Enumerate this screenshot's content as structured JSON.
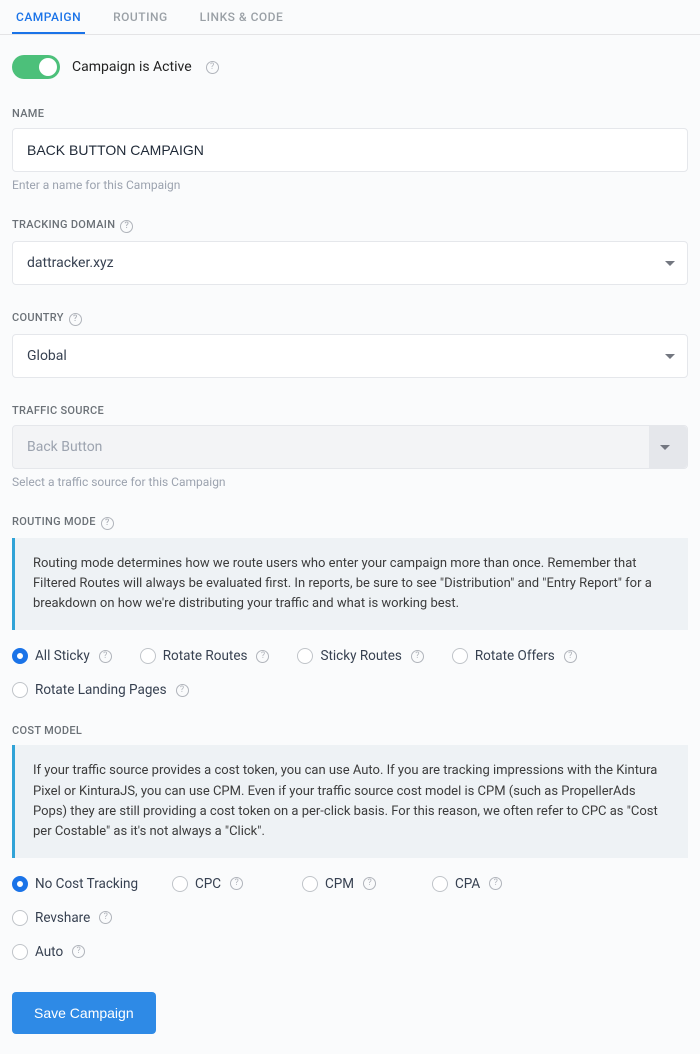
{
  "tabs": {
    "campaign": "CAMPAIGN",
    "routing": "ROUTING",
    "links": "LINKS & CODE"
  },
  "toggle": {
    "label": "Campaign is Active"
  },
  "name": {
    "label": "NAME",
    "value": "BACK BUTTON CAMPAIGN",
    "hint": "Enter a name for this Campaign"
  },
  "trackingDomain": {
    "label": "TRACKING DOMAIN",
    "value": "dattracker.xyz"
  },
  "country": {
    "label": "COUNTRY",
    "value": "Global"
  },
  "trafficSource": {
    "label": "TRAFFIC SOURCE",
    "value": "Back Button",
    "hint": "Select a traffic source for this Campaign"
  },
  "routingMode": {
    "label": "ROUTING MODE",
    "info": "Routing mode determines how we route users who enter your campaign more than once. Remember that Filtered Routes will always be evaluated first. In reports, be sure to see \"Distribution\" and \"Entry Report\" for a breakdown on how we're distributing your traffic and what is working best.",
    "options": {
      "allSticky": "All Sticky",
      "rotateRoutes": "Rotate Routes",
      "stickyRoutes": "Sticky Routes",
      "rotateOffers": "Rotate Offers",
      "rotateLanding": "Rotate Landing Pages"
    }
  },
  "costModel": {
    "label": "COST MODEL",
    "info": "If your traffic source provides a cost token, you can use Auto. If you are tracking impressions with the Kintura Pixel or KinturaJS, you can use CPM. Even if your traffic source cost model is CPM (such as PropellerAds Pops) they are still providing a cost token on a per-click basis. For this reason, we often refer to CPC as \"Cost per Costable\" as it's not always a \"Click\".",
    "options": {
      "none": "No Cost Tracking",
      "cpc": "CPC",
      "cpm": "CPM",
      "cpa": "CPA",
      "revshare": "Revshare",
      "auto": "Auto"
    }
  },
  "saveButton": "Save Campaign"
}
